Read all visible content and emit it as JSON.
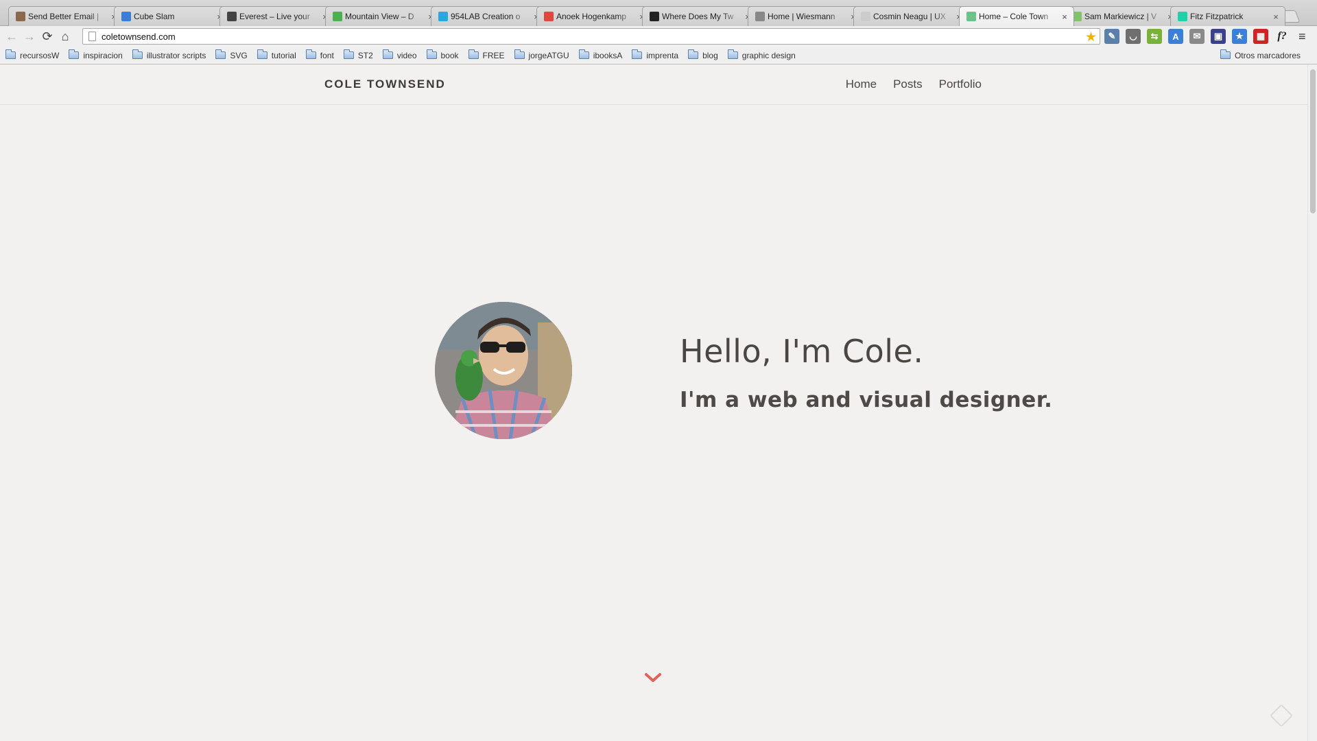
{
  "browser": {
    "tabs": [
      {
        "title": "Send Better Email |",
        "favicon_color": "#8a6a4a"
      },
      {
        "title": "Cube Slam",
        "favicon_color": "#3b7dd8"
      },
      {
        "title": "Everest – Live your",
        "favicon_color": "#444444"
      },
      {
        "title": "Mountain View – D",
        "favicon_color": "#4caf50"
      },
      {
        "title": "954LAB Creation o",
        "favicon_color": "#29a8e0"
      },
      {
        "title": "Anoek Hogenkamp",
        "favicon_color": "#e0483e"
      },
      {
        "title": "Where Does My Tw",
        "favicon_color": "#222222"
      },
      {
        "title": "Home | Wiesmann",
        "favicon_color": "#888888"
      },
      {
        "title": "Cosmin Neagu | UX",
        "favicon_color": "#cccccc"
      },
      {
        "title": "Home – Cole Town",
        "favicon_color": "#6cc38a",
        "active": true
      },
      {
        "title": "Sam Markiewicz | V",
        "favicon_color": "#7fc36b"
      },
      {
        "title": "Fitz Fitzpatrick",
        "favicon_color": "#1fd1a8"
      }
    ],
    "address": "coletownsend.com",
    "extensions": [
      {
        "name": "eyedropper-icon",
        "color": "#5a7fa8",
        "glyph": "✎"
      },
      {
        "name": "pocket-icon",
        "color": "#6f6f6f",
        "glyph": "◡"
      },
      {
        "name": "sync-icon",
        "color": "#79b23a",
        "glyph": "⇆"
      },
      {
        "name": "translate-icon",
        "color": "#3c7fd6",
        "glyph": "A"
      },
      {
        "name": "mail-icon",
        "color": "#8a8a8a",
        "glyph": "✉"
      },
      {
        "name": "screen-icon",
        "color": "#3a3f8f",
        "glyph": "▣"
      },
      {
        "name": "bookmark-star-icon",
        "color": "#3c7fd6",
        "glyph": "★"
      },
      {
        "name": "red-grid-icon",
        "color": "#d22323",
        "glyph": "▦"
      },
      {
        "name": "font-ext-icon",
        "color": "#efefef",
        "glyph": "f?"
      }
    ],
    "bookmarks": [
      "recursosW",
      "inspiracion",
      "illustrator scripts",
      "SVG",
      "tutorial",
      "font",
      "ST2",
      "video",
      "book",
      "FREE",
      "jorgeATGU",
      "ibooksA",
      "imprenta",
      "blog",
      "graphic design"
    ],
    "other_bookmarks": "Otros marcadores"
  },
  "site": {
    "logo": "COLE TOWNSEND",
    "nav": [
      "Home",
      "Posts",
      "Portfolio"
    ],
    "hero_title": "Hello, I'm Cole.",
    "hero_subtitle": "I'm a web and visual designer.",
    "accent": "#e0625a"
  }
}
